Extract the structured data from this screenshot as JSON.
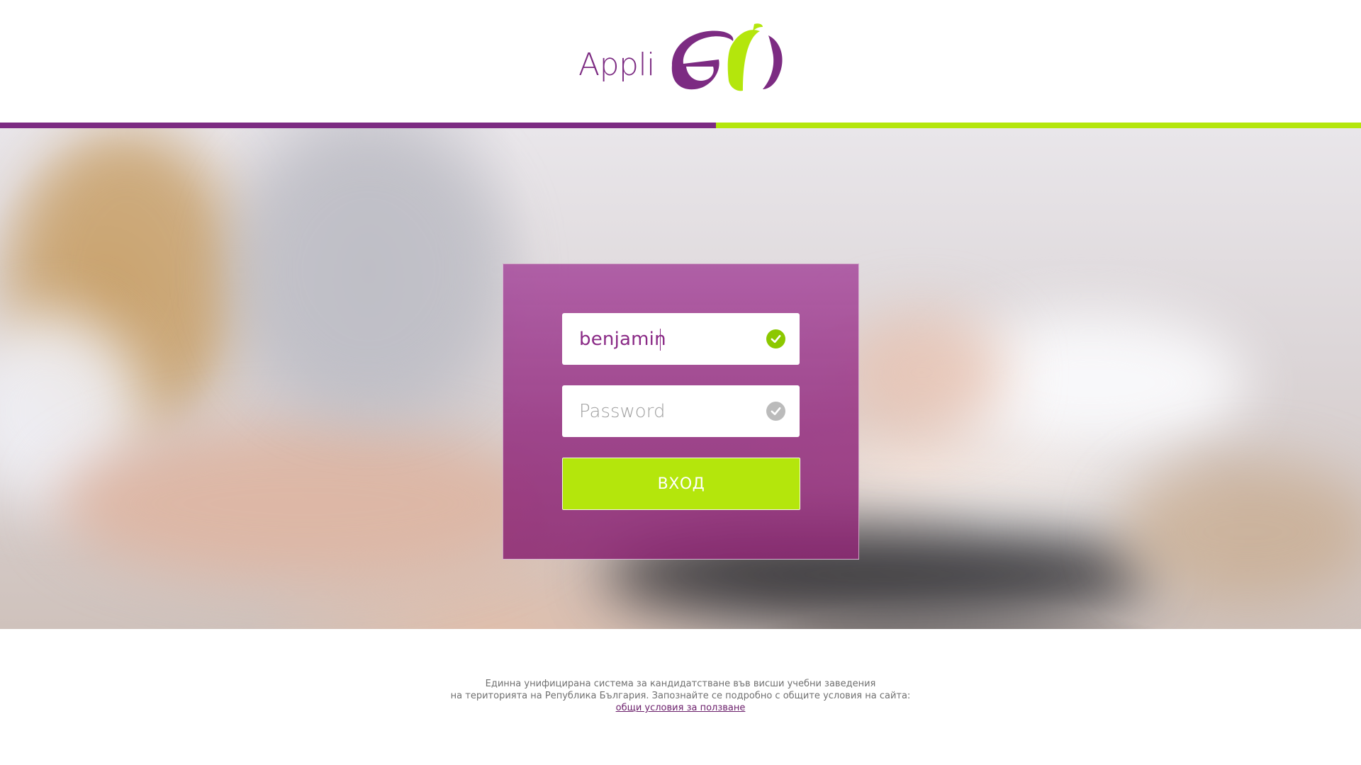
{
  "brand": {
    "logo_text": "Appli",
    "primary_color": "#7c2b82",
    "accent_color": "#b4e60c"
  },
  "login": {
    "username_value": "benjamin",
    "password_placeholder": "Password",
    "submit_label": "ВХОД",
    "username_check_color": "#8cc800",
    "password_check_color": "#bbbbbb"
  },
  "footer": {
    "line1": "Единна унифицирана система за кандидатстване във висши учебни заведения",
    "line2": "на територията на Република България. Запознайте се подробно с общите условия на сайта:",
    "terms_link": "общи условия за ползване"
  },
  "icons": {
    "username_status": "check-circle-icon",
    "password_status": "check-circle-icon"
  }
}
